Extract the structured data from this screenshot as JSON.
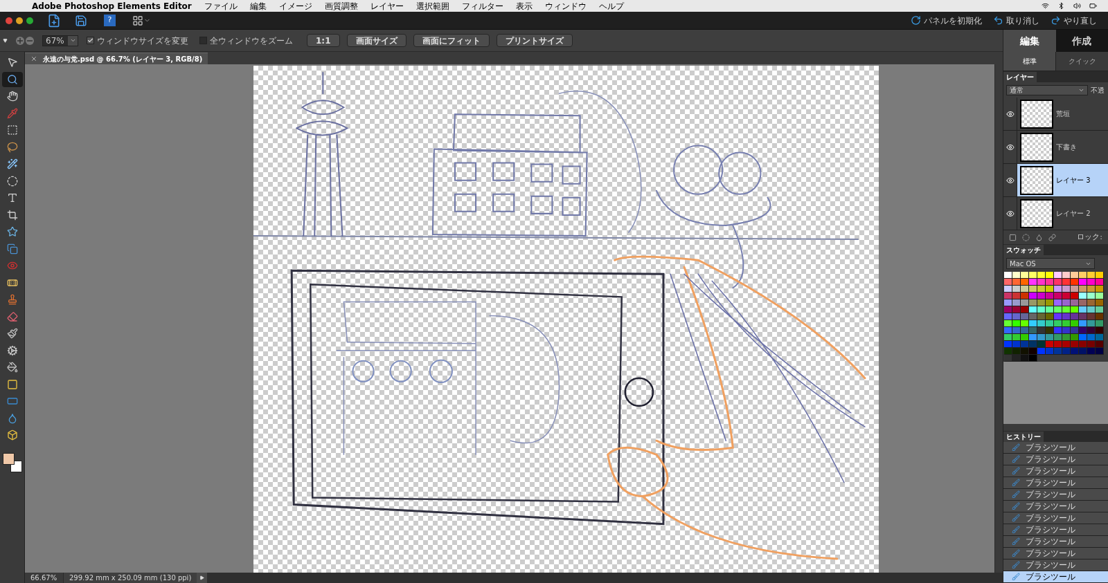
{
  "menu_bar": {
    "app_name": "Adobe Photoshop Elements Editor",
    "items": [
      "ファイル",
      "編集",
      "イメージ",
      "画質調整",
      "レイヤー",
      "選択範囲",
      "フィルター",
      "表示",
      "ウィンドウ",
      "ヘルプ"
    ]
  },
  "app_bar": {
    "actions": [
      {
        "kind": "reset",
        "label": "パネルを初期化"
      },
      {
        "kind": "undo",
        "label": "取り消し"
      },
      {
        "kind": "redo",
        "label": "やり直し"
      }
    ]
  },
  "options_bar": {
    "zoom_value": "67%",
    "checkboxes": [
      {
        "label": "ウィンドウサイズを変更",
        "checked": true
      },
      {
        "label": "全ウィンドウをズーム",
        "checked": false
      }
    ],
    "buttons": [
      "1:1",
      "画面サイズ",
      "画面にフィット",
      "プリントサイズ"
    ]
  },
  "document_tab": {
    "title": "永遠の与党.psd @ 66.7% (レイヤー 3, RGB/8)"
  },
  "tools": [
    {
      "kind": "move",
      "selected": false
    },
    {
      "kind": "zoom",
      "selected": true
    },
    {
      "kind": "hand",
      "selected": false
    },
    {
      "kind": "eyedropper",
      "selected": false
    },
    {
      "kind": "marquee",
      "selected": false
    },
    {
      "kind": "lasso",
      "selected": false
    },
    {
      "kind": "wand",
      "selected": false
    },
    {
      "kind": "quick",
      "selected": false
    },
    {
      "kind": "type",
      "selected": false
    },
    {
      "kind": "crop",
      "selected": false
    },
    {
      "kind": "shape",
      "selected": false
    },
    {
      "kind": "recompose",
      "selected": false
    },
    {
      "kind": "redeye",
      "selected": false
    },
    {
      "kind": "heal",
      "selected": false
    },
    {
      "kind": "stamp",
      "selected": false
    },
    {
      "kind": "eraser",
      "selected": false
    },
    {
      "kind": "brush",
      "selected": false
    },
    {
      "kind": "smartbrush",
      "selected": false
    },
    {
      "kind": "bucket",
      "selected": false
    },
    {
      "kind": "gradient",
      "selected": false
    },
    {
      "kind": "rect",
      "selected": false
    },
    {
      "kind": "blur",
      "selected": false
    },
    {
      "kind": "sponge",
      "selected": false
    }
  ],
  "help_button": {
    "label": "?"
  },
  "status_bar": {
    "zoom": "66.67%",
    "size": "299.92 mm x 250.09 mm (130 ppi)"
  },
  "panel_tabs": [
    {
      "label": "編集",
      "selected": true
    },
    {
      "label": "作成",
      "selected": false
    }
  ],
  "mode_tabs": [
    {
      "label": "標準",
      "selected": true
    },
    {
      "label": "クイック",
      "selected": false
    }
  ],
  "layers": {
    "title": "レイヤー",
    "blend_mode": "通常",
    "opacity_label": "不透",
    "lock_label": "ロック:",
    "items": [
      {
        "name": "荒垣",
        "visible": true,
        "selected": false
      },
      {
        "name": "下書き",
        "visible": true,
        "selected": false
      },
      {
        "name": "レイヤー 3",
        "visible": true,
        "selected": true
      },
      {
        "name": "レイヤー 2",
        "visible": true,
        "selected": false
      }
    ]
  },
  "swatches": {
    "title": "スウォッチ",
    "set": "Mac OS"
  },
  "history": {
    "title": "ヒストリー",
    "items": [
      {
        "label": "ブラシツール",
        "selected": false
      },
      {
        "label": "ブラシツール",
        "selected": false
      },
      {
        "label": "ブラシツール",
        "selected": false
      },
      {
        "label": "ブラシツール",
        "selected": false
      },
      {
        "label": "ブラシツール",
        "selected": false
      },
      {
        "label": "ブラシツール",
        "selected": false
      },
      {
        "label": "ブラシツール",
        "selected": false
      },
      {
        "label": "ブラシツール",
        "selected": false
      },
      {
        "label": "ブラシツール",
        "selected": false
      },
      {
        "label": "ブラシツール",
        "selected": false
      },
      {
        "label": "ブラシツール",
        "selected": false
      },
      {
        "label": "ブラシツール",
        "selected": true
      }
    ]
  }
}
